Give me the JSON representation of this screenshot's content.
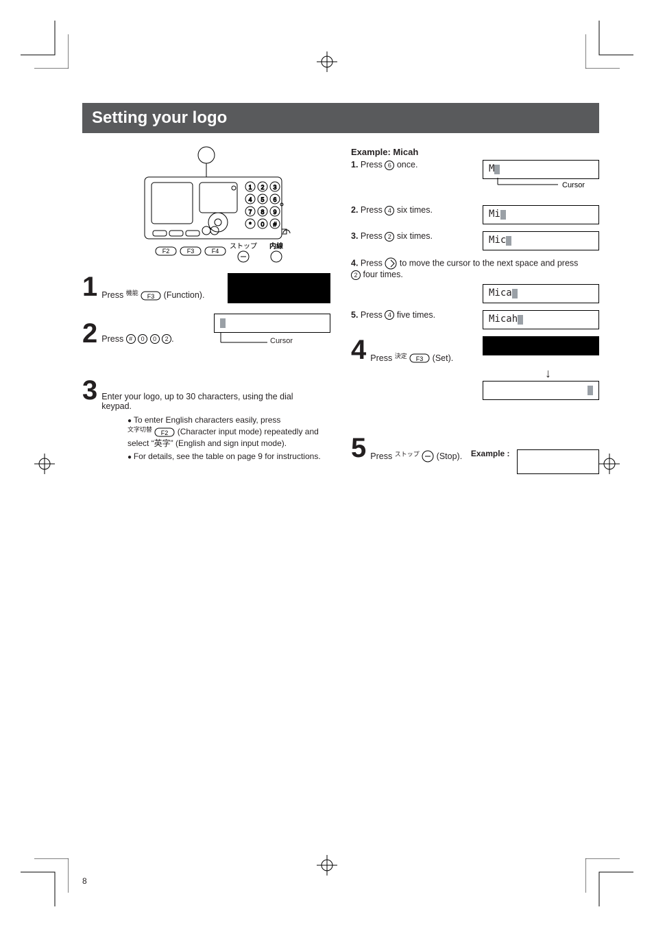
{
  "title": "Setting your logo",
  "page_number": "8",
  "left": {
    "step1_prefix": "Press ",
    "step1_suffix": " (Function).",
    "f3_top": "機能",
    "f3_key": "F3",
    "step2_prefix": "Press ",
    "step2_keys": [
      "#",
      "0",
      "0",
      "2"
    ],
    "step2_suffix": ".",
    "cursor_label": "Cursor",
    "step3": "Enter your logo, up to 30 characters, using the dial keypad.",
    "bullet1_a": "To enter English characters easily, press ",
    "bullet1_b": " (Character input mode) repeatedly and select “英字” (English and sign input mode).",
    "f2_top": "文字切替",
    "f2_key": "F2",
    "bullet2": "For details, see the table on page 9 for instructions.",
    "keypad_labels": {
      "f2": "F2",
      "f3": "F3",
      "f4": "F4",
      "stop": "ストップ",
      "ext": "内線"
    }
  },
  "right": {
    "example_title": "Example: Micah",
    "s1_prefix": "1.",
    "s1_body": "Press ",
    "s1_key": "6",
    "s1_suffix": " once.",
    "s2_prefix": "2.",
    "s2_body": "Press ",
    "s2_key": "4",
    "s2_suffix": " six times.",
    "s3_prefix": "3.",
    "s3_body": "Press ",
    "s3_key": "2",
    "s3_suffix": " six times.",
    "s4_prefix": "4.",
    "s4_body_a": "Press ",
    "s4_body_b": " to move the cursor to the next space and press ",
    "s4_key2": "2",
    "s4_suffix": " four times.",
    "s5_prefix": "5.",
    "s5_body": "Press ",
    "s5_key": "4",
    "s5_suffix": " five times.",
    "cursor_label": "Cursor",
    "lcd1": "M",
    "lcd2": "Mi",
    "lcd3": "Mic",
    "lcd4": "Mica",
    "lcd5": "Micah",
    "step4_prefix": "Press ",
    "step4_top": "決定",
    "step4_key": "F3",
    "step4_suffix": " (Set).",
    "step5_prefix": "Press ",
    "step5_top": "ストップ",
    "step5_suffix": " (Stop).",
    "example_label": "Example :"
  }
}
